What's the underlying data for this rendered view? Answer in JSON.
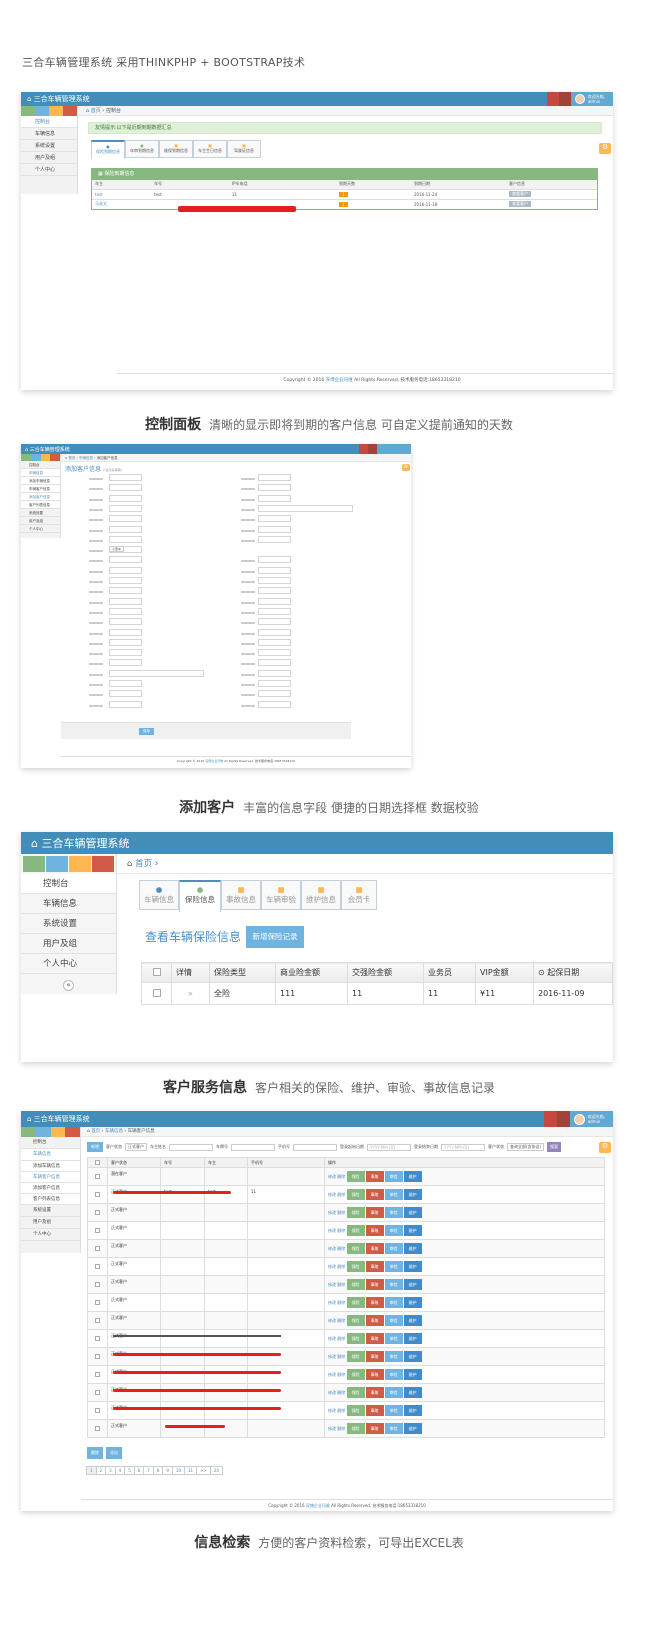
{
  "header": "三合车辆管理系统    采用THINKPHP + BOOTSTRAP技术",
  "app": {
    "title": "三合车辆管理系统",
    "user_greeting": "欢迎光临,",
    "user_name": "admin"
  },
  "sidebar": {
    "items": [
      "控制台",
      "车辆信息",
      "系统设置",
      "用户及组",
      "个人中心"
    ],
    "sub_items": [
      "添加车辆信息",
      "车辆客户信息",
      "添加客户信息",
      "客户列表信息"
    ]
  },
  "crumb": {
    "home": "首页",
    "dashboard": "控制台",
    "vehicle": "车辆信息",
    "list": "车辆客户信息",
    "add": "添加客户信息"
  },
  "dash": {
    "alert": "友情提示:以下是近期到期数据汇总",
    "tabs": [
      "保险到期信息",
      "年审到期信息",
      "维保到期信息",
      "车主生日信息",
      "驾驶证信息"
    ],
    "panel": "保险到期信息",
    "cols": [
      "车主",
      "车号",
      "IP车电话",
      "到期天数",
      "到期日期",
      "客户信息"
    ],
    "rows": [
      {
        "owner": "test",
        "plate": "test",
        "phone": "11",
        "days": "1",
        "date": "2016-11-24",
        "btn": "查看客户"
      },
      {
        "owner": "马永太",
        "plate": "",
        "phone": "",
        "days": "1",
        "date": "2016-11-18",
        "btn": "查看客户"
      }
    ]
  },
  "footer": {
    "prefix": "Copyright © 2016",
    "link": "深博企业讯维",
    "suffix": "All Rights Reserved, 技术服务电话:18653318210"
  },
  "cap1": {
    "bold": "控制面板",
    "text": "清晰的显示即将到期的客户信息 可自定义提前通知的天数"
  },
  "cap2": {
    "bold": "添加客户",
    "text": "丰富的信息字段 便捷的日期选择框 数据校验"
  },
  "cap3": {
    "bold": "客户服务信息",
    "text": "客户相关的保险、维护、审验、事故信息记录"
  },
  "cap4": {
    "bold": "信息检索",
    "text": "方便的客户资料检索，可导出EXCEL表"
  },
  "add": {
    "title": "添加客户信息",
    "sub": "(*表示必填项)",
    "select": "小型车",
    "submit": "保存"
  },
  "ins": {
    "tabs": [
      "车辆信息",
      "保险信息",
      "事故信息",
      "车辆审验",
      "维护信息",
      "会员卡"
    ],
    "title": "查看车辆保险信息",
    "add_btn": "新增保险记录",
    "cols": [
      "",
      "详情",
      "保险类型",
      "商业险金额",
      "交强险金额",
      "业务员",
      "VIP金额",
      "起保日期"
    ],
    "row": {
      "type": "全险",
      "commercial": "111",
      "compulsory": "11",
      "agent": "11",
      "vip": "¥11",
      "date": "2016-11-09"
    }
  },
  "search": {
    "new_btn": "新增",
    "filters": [
      "客户状态",
      "正式客户",
      "车主姓名",
      "车牌号",
      "手机号",
      "登录起始日期",
      "YYYY-MM-DD",
      "登录结束日期",
      "YYYY-MM-DD",
      "客户状态",
      "查询全部(含协议)",
      "搜索"
    ],
    "cols": [
      "",
      "客户状态",
      "车号",
      "车主",
      "手机号",
      "",
      "操作"
    ],
    "rows": [
      {
        "status": "潜在客户",
        "plate": "",
        "owner": "",
        "phone": ""
      },
      {
        "status": "正式客户",
        "plate": "test",
        "owner": "test",
        "phone": "11"
      },
      {
        "status": "正式客户",
        "plate": "",
        "owner": "",
        "phone": ""
      },
      {
        "status": "正式客户",
        "plate": "",
        "owner": "",
        "phone": ""
      },
      {
        "status": "正式客户",
        "plate": "",
        "owner": "",
        "phone": ""
      },
      {
        "status": "正式客户",
        "plate": "",
        "owner": "",
        "phone": ""
      },
      {
        "status": "正式客户",
        "plate": "",
        "owner": "",
        "phone": ""
      },
      {
        "status": "正式客户",
        "plate": "",
        "owner": "",
        "phone": ""
      },
      {
        "status": "正式客户",
        "plate": "",
        "owner": "",
        "phone": ""
      },
      {
        "status": "正式客户",
        "plate": "",
        "owner": "",
        "phone": ""
      },
      {
        "status": "正式客户",
        "plate": "",
        "owner": "",
        "phone": ""
      },
      {
        "status": "正式客户",
        "plate": "",
        "owner": "",
        "phone": ""
      },
      {
        "status": "正式客户",
        "plate": "",
        "owner": "",
        "phone": ""
      },
      {
        "status": "正式客户",
        "plate": "",
        "owner": "",
        "phone": ""
      },
      {
        "status": "正式客户",
        "plate": "",
        "owner": "",
        "phone": ""
      }
    ],
    "ops": [
      "修改",
      "删除",
      "保险",
      "事故",
      "审验",
      "维护"
    ],
    "bottom": [
      "删除",
      "导出"
    ],
    "pages": [
      "1",
      "2",
      "3",
      "4",
      "5",
      "6",
      "7",
      "8",
      "9",
      "10",
      "11",
      ">>",
      "24"
    ]
  },
  "colors": {
    "nav": "#438eb9",
    "green": "#87b87f",
    "red": "#d15b47",
    "blue": "#428bca",
    "orange": "#ffb752"
  }
}
